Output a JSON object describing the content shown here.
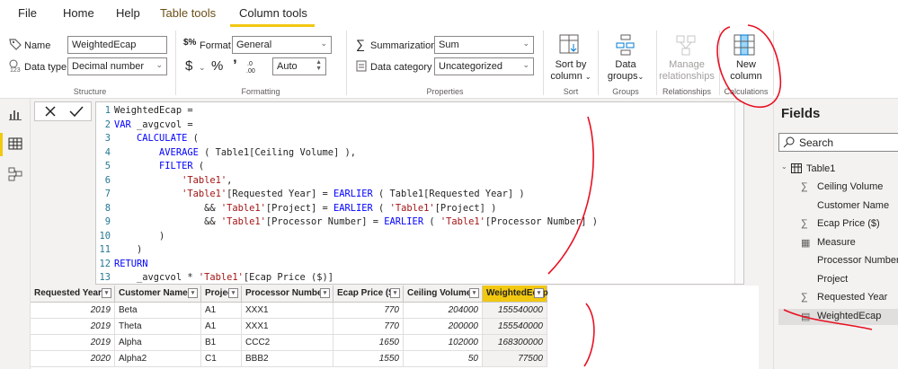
{
  "menu": {
    "tabs": [
      {
        "label": "File"
      },
      {
        "label": "Home"
      },
      {
        "label": "Help"
      },
      {
        "label": "Table tools"
      },
      {
        "label": "Column tools"
      }
    ]
  },
  "ribbon": {
    "structure": {
      "name_label": "Name",
      "name_value": "WeightedEcap",
      "datatype_label": "Data type",
      "datatype_value": "Decimal number",
      "group_label": "Structure"
    },
    "formatting": {
      "format_label": "Format",
      "format_value": "General",
      "currency_symbol": "$",
      "percent_symbol": "%",
      "comma_symbol": "’",
      "decimals_value": "Auto",
      "group_label": "Formatting"
    },
    "properties": {
      "summarization_label": "Summarization",
      "summarization_value": "Sum",
      "category_label": "Data category",
      "category_value": "Uncategorized",
      "group_label": "Properties"
    },
    "sort": {
      "label_line1": "Sort by",
      "label_line2": "column",
      "group_label": "Sort"
    },
    "groups": {
      "label_line1": "Data",
      "label_line2": "groups",
      "group_label": "Groups"
    },
    "relationships": {
      "label_line1": "Manage",
      "label_line2": "relationships",
      "group_label": "Relationships"
    },
    "calculations": {
      "label_line1": "New",
      "label_line2": "column",
      "group_label": "Calculations"
    }
  },
  "editor": {
    "lines": [
      {
        "n": "1",
        "segments": [
          [
            "",
            "WeightedEcap ="
          ]
        ]
      },
      {
        "n": "2",
        "segments": [
          [
            "kw",
            "VAR"
          ],
          [
            "",
            " _avgcvol ="
          ]
        ]
      },
      {
        "n": "3",
        "segments": [
          [
            "",
            "    "
          ],
          [
            "fn",
            "CALCULATE"
          ],
          [
            "",
            " ("
          ]
        ]
      },
      {
        "n": "4",
        "segments": [
          [
            "",
            "        "
          ],
          [
            "fn",
            "AVERAGE"
          ],
          [
            "",
            " ( Table1[Ceiling Volume] ),"
          ]
        ]
      },
      {
        "n": "5",
        "segments": [
          [
            "",
            "        "
          ],
          [
            "fn",
            "FILTER"
          ],
          [
            "",
            " ("
          ]
        ]
      },
      {
        "n": "6",
        "segments": [
          [
            "",
            "            "
          ],
          [
            "str",
            "'Table1'"
          ],
          [
            "",
            ","
          ]
        ]
      },
      {
        "n": "7",
        "segments": [
          [
            "",
            "            "
          ],
          [
            "str",
            "'Table1'"
          ],
          [
            "",
            "[Requested Year] = "
          ],
          [
            "fn",
            "EARLIER"
          ],
          [
            "",
            " ( Table1[Requested Year] )"
          ]
        ]
      },
      {
        "n": "8",
        "segments": [
          [
            "",
            "                && "
          ],
          [
            "str",
            "'Table1'"
          ],
          [
            "",
            "[Project] = "
          ],
          [
            "fn",
            "EARLIER"
          ],
          [
            "",
            " ( "
          ],
          [
            "str",
            "'Table1'"
          ],
          [
            "",
            "[Project] )"
          ]
        ]
      },
      {
        "n": "9",
        "segments": [
          [
            "",
            "                && "
          ],
          [
            "str",
            "'Table1'"
          ],
          [
            "",
            "[Processor Number] = "
          ],
          [
            "fn",
            "EARLIER"
          ],
          [
            "",
            " ( "
          ],
          [
            "str",
            "'Table1'"
          ],
          [
            "",
            "[Processor Number] )"
          ]
        ]
      },
      {
        "n": "10",
        "segments": [
          [
            "",
            "        )"
          ]
        ]
      },
      {
        "n": "11",
        "segments": [
          [
            "",
            "    )"
          ]
        ]
      },
      {
        "n": "12",
        "segments": [
          [
            "kw",
            "RETURN"
          ]
        ]
      },
      {
        "n": "13",
        "segments": [
          [
            "",
            "    _avgcvol * "
          ],
          [
            "str",
            "'Table1'"
          ],
          [
            "",
            "[Ecap Price ($)]"
          ]
        ]
      }
    ]
  },
  "table": {
    "columns": [
      "Requested Year",
      "Customer Name",
      "Project",
      "Processor Number",
      "Ecap Price ($)",
      "Ceiling Volume",
      "WeightedEcap"
    ],
    "rows": [
      [
        "2019",
        "Beta",
        "A1",
        "XXX1",
        "770",
        "204000",
        "155540000"
      ],
      [
        "2019",
        "Theta",
        "A1",
        "XXX1",
        "770",
        "200000",
        "155540000"
      ],
      [
        "2019",
        "Alpha",
        "B1",
        "CCC2",
        "1650",
        "102000",
        "168300000"
      ],
      [
        "2020",
        "Alpha2",
        "C1",
        "BBB2",
        "1550",
        "50",
        "77500"
      ]
    ]
  },
  "fields": {
    "title": "Fields",
    "search_placeholder": "Search",
    "table_name": "Table1",
    "items": [
      {
        "label": "Ceiling Volume",
        "icon": "sigma-icon"
      },
      {
        "label": "Customer Name",
        "icon": ""
      },
      {
        "label": "Ecap Price ($)",
        "icon": "sigma-icon"
      },
      {
        "label": "Measure",
        "icon": "calculator-icon"
      },
      {
        "label": "Processor Number",
        "icon": ""
      },
      {
        "label": "Project",
        "icon": ""
      },
      {
        "label": "Requested Year",
        "icon": "sigma-icon"
      },
      {
        "label": "WeightedEcap",
        "icon": "calculated-column-icon"
      }
    ]
  },
  "colors": {
    "accent": "#f2c811",
    "annotation": "#e81123",
    "keyword": "#0000ff",
    "string": "#a31515"
  }
}
